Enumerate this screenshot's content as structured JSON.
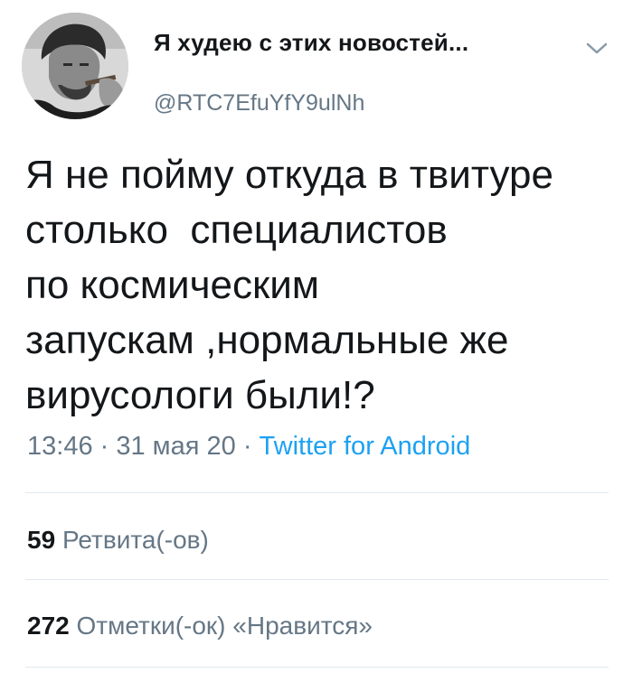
{
  "author": {
    "display_name": "Я худею с этих новостей...",
    "handle": "@RTC7EfuYfY9ulNh",
    "avatar_icon": "profile-photo",
    "menu_icon": "chevron-down-icon"
  },
  "tweet": {
    "text": "Я не пойму откуда в твитуре\nстолько  специалистов\nпо космическим\nзапускам ,нормальные же\nвирусологи были!?",
    "time": "13:46",
    "date": "31 мая 20",
    "separator": " · ",
    "source": "Twitter for Android"
  },
  "stats": {
    "retweets": {
      "count": "59",
      "label": "Ретвита(-ов)"
    },
    "likes": {
      "count": "272",
      "label": "Отметки(-ок) «Нравится»"
    }
  },
  "colors": {
    "text": "#14171a",
    "secondary": "#657786",
    "link": "#1da1f2",
    "divider": "#e1e8ed"
  }
}
